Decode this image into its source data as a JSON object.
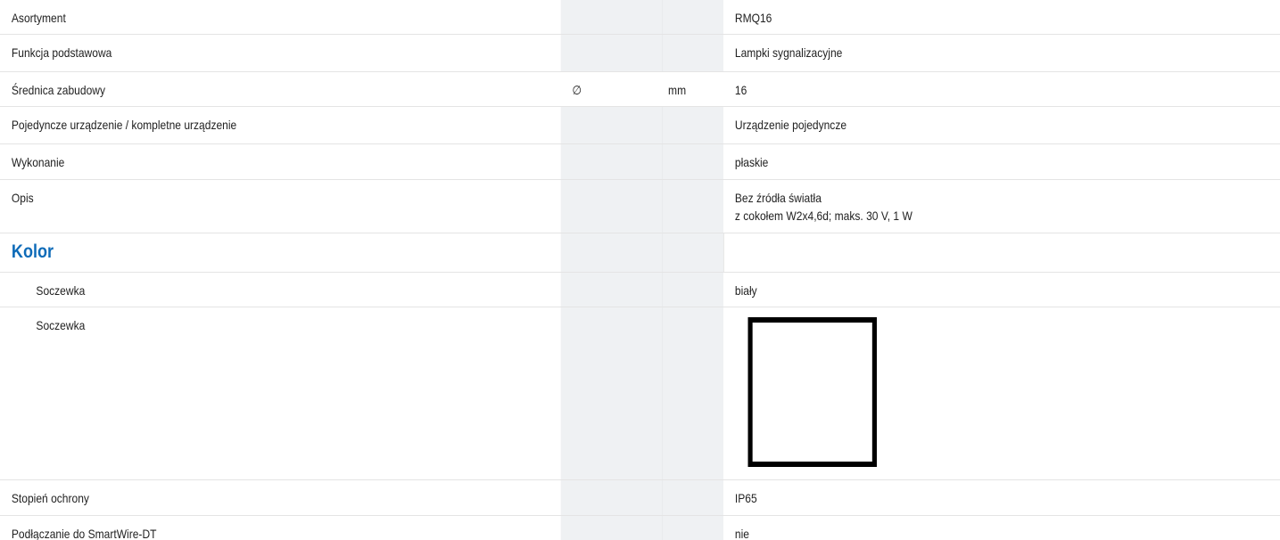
{
  "rows": [
    {
      "label": "Asortyment",
      "symbol": "",
      "unit": "",
      "value": "RMQ16"
    },
    {
      "label": "Funkcja podstawowa",
      "symbol": "",
      "unit": "",
      "value": "Lampki sygnalizacyjne"
    },
    {
      "label": "Średnica zabudowy",
      "symbol": "∅",
      "unit": "mm",
      "value": "16"
    },
    {
      "label": "Pojedyncze urządzenie / kompletne urządzenie",
      "symbol": "",
      "unit": "",
      "value": "Urządzenie pojedyncze"
    },
    {
      "label": "Wykonanie",
      "symbol": "",
      "unit": "",
      "value": "płaskie"
    },
    {
      "label": "Opis",
      "symbol": "",
      "unit": "",
      "value_line1": "Bez źródła światła",
      "value_line2": "z cokołem W2x4,6d; maks. 30 V, 1 W"
    }
  ],
  "color_section": {
    "heading": "Kolor",
    "rows": [
      {
        "label": "Soczewka",
        "value": "biały"
      },
      {
        "label": "Soczewka",
        "swatch_color": "#ffffff",
        "swatch_border": "#000000"
      }
    ]
  },
  "rows_after": [
    {
      "label": "Stopień ochrony",
      "value": "IP65"
    },
    {
      "label": "Podłączanie do SmartWire-DT",
      "value": "nie"
    }
  ],
  "colors": {
    "heading": "#0e6bb8",
    "shaded_column": "#eff1f3",
    "row_border": "#e4e4e4"
  }
}
